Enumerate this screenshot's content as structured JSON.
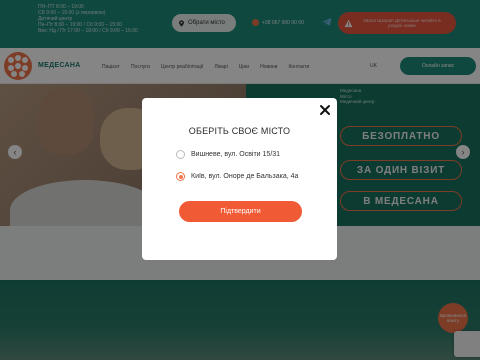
{
  "header": {
    "info_lines": [
      "ПН–ПТ 8:00 – 19:00",
      "СБ 9:00 – 15:00 (з перервою)",
      "Дитячий центр",
      "Пн–Пт 8:00 – 19:00 / Сб 9:00 – 15:00",
      "Вих: Нд / Пт 17:00 – 18:00 / Сб 9:00 – 15:00"
    ],
    "city_selector": "Обрати місто",
    "phone": "+38 067 000 00 00",
    "alert_text": "Увага! Шахраї! Детальніше читайте в розділі новин"
  },
  "nav": {
    "brand": "МЕДЕСАНА",
    "menu": [
      "Пацієнт",
      "Послуги",
      "Центр реабілітації",
      "Лікарі",
      "Ціни",
      "Новини",
      "Контакти"
    ],
    "lang": "UK",
    "online_button": "Онлайн запис"
  },
  "hero": {
    "caption_lines": [
      "Медесана",
      "Місто",
      "Медичний центр"
    ],
    "slogans": [
      "БЕЗОПЛАТНО",
      "ЗА ОДИН ВІЗИТ",
      "В МЕДЕСАНА"
    ]
  },
  "fab": {
    "label": "Бронювання візиту"
  },
  "modal": {
    "title": "ОБЕРІТЬ СВОЄ МІСТО",
    "options": [
      {
        "label": "Вишневе, вул. Освіти 15/31",
        "selected": false
      },
      {
        "label": "Київ, вул. Оноре де Бальзака, 4а",
        "selected": true
      }
    ],
    "confirm_label": "Підтвердити"
  },
  "colors": {
    "brand_green": "#1d8a7a",
    "accent_orange": "#f0734a",
    "button_orange": "#f05a35"
  }
}
